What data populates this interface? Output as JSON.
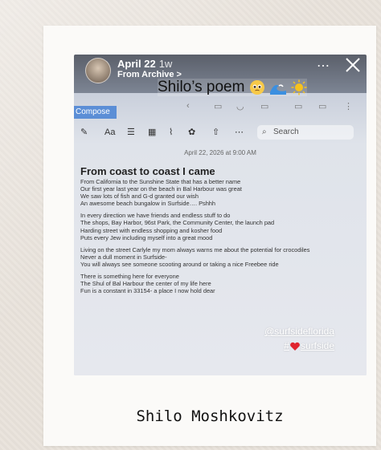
{
  "instagram": {
    "username": "April 22",
    "time_ago": "1w",
    "archive_link": "From Archive >",
    "caption": "Shilo’s poem"
  },
  "notes_app": {
    "compose_tab": "Compose",
    "search_placeholder": "Search",
    "aa_label": "Aa",
    "date": "April 22, 2026 at 9:00 AM",
    "title": "From coast to coast I came",
    "lines": [
      "From California to the Sunshine State that has a better name",
      "Our first year last year on the beach in Bal Harbour was great",
      "We saw lots of fish and G-d granted our wish",
      "An awesome beach bungalow in Surfside…. Pshhh",
      "",
      "In every direction we have friends and endless  stuff to do",
      "The shops, Bay Harbor, 96st Park, the Community Center, the launch pad",
      "Harding street with endless shopping and kosher food",
      "Puts every Jew including myself into a great mood",
      "",
      "Living on the street Carlyle my mom always warns me about the potential for crocodiles",
      "Never a dull moment in Surfside-",
      "You will always see someone scooting around or taking a nice Freebee ride",
      "",
      "There is something here for everyone",
      "The Shul of Bal Harbour the center of my life here",
      "Fun is a constant in 33154- a place I now hold dear"
    ]
  },
  "tags": {
    "handle": "@surfsideflorida",
    "hashtag_prefix": "#",
    "hashtag_text": "surfside"
  },
  "author": "Shilo Moshkovitz"
}
